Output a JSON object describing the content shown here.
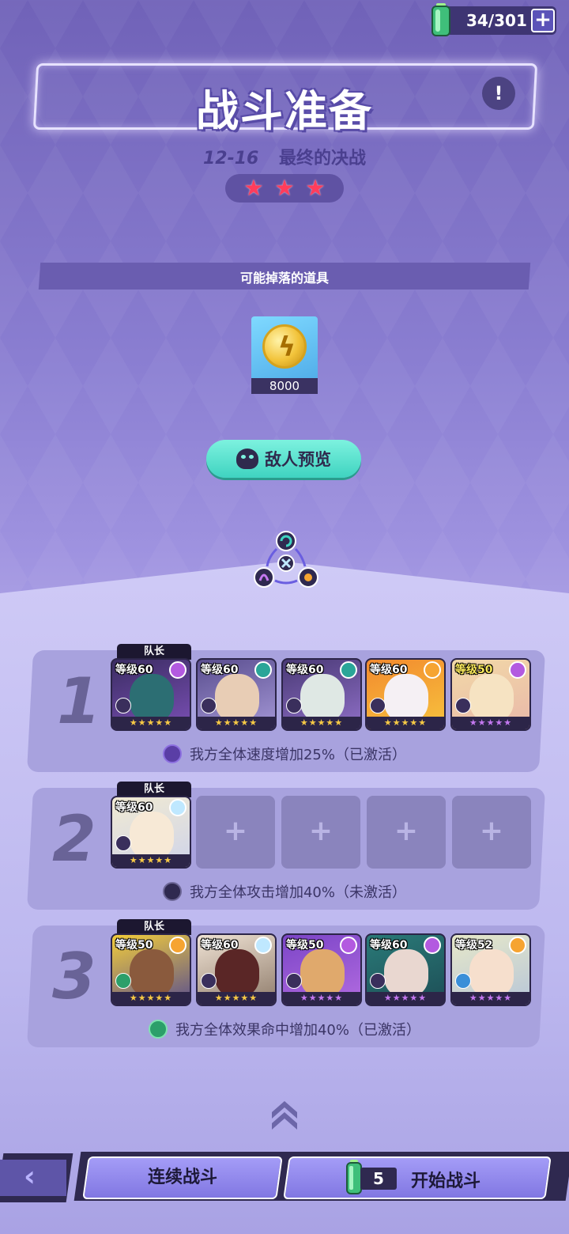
{
  "resource": {
    "energy": "34/301",
    "plus": "+"
  },
  "header": {
    "title": "战斗准备",
    "stage_number": "12-16",
    "stage_name": "最终的决战",
    "info": "!",
    "stars": [
      "★",
      "★",
      "★"
    ]
  },
  "drops": {
    "label": "可能掉落的道具",
    "items": [
      {
        "icon": "gold-coin-icon",
        "count": "8000"
      }
    ]
  },
  "enemy_preview": {
    "label": "敌人预览"
  },
  "teams": [
    {
      "number": "1",
      "captain": "队长",
      "heroes": [
        {
          "level": "等级60",
          "stars": "★★★★★"
        },
        {
          "level": "等级60",
          "stars": "★★★★★"
        },
        {
          "level": "等级60",
          "stars": "★★★★★"
        },
        {
          "level": "等级60",
          "stars": "★★★★★"
        },
        {
          "level": "等级50",
          "stars": "★★★★★"
        }
      ],
      "bonus": "我方全体速度增加25%（已激活）"
    },
    {
      "number": "2",
      "captain": "队长",
      "heroes": [
        {
          "level": "等级60",
          "stars": "★★★★★"
        }
      ],
      "empty_slot": "+",
      "bonus": "我方全体攻击增加40%（未激活）"
    },
    {
      "number": "3",
      "captain": "队长",
      "heroes": [
        {
          "level": "等级50",
          "stars": "★★★★★"
        },
        {
          "level": "等级60",
          "stars": "★★★★★"
        },
        {
          "level": "等级50",
          "stars": "★★★★★"
        },
        {
          "level": "等级60",
          "stars": "★★★★★"
        },
        {
          "level": "等级52",
          "stars": "★★★★★"
        }
      ],
      "bonus": "我方全体效果命中增加40%（已激活）"
    }
  ],
  "bottom": {
    "back": "‹",
    "continuous": "连续战斗",
    "start_cost": "5",
    "start": "开始战斗"
  },
  "colors": {
    "accent": "#3fd3c0",
    "star": "#ff3d5c",
    "panel": "#a8a2de"
  }
}
